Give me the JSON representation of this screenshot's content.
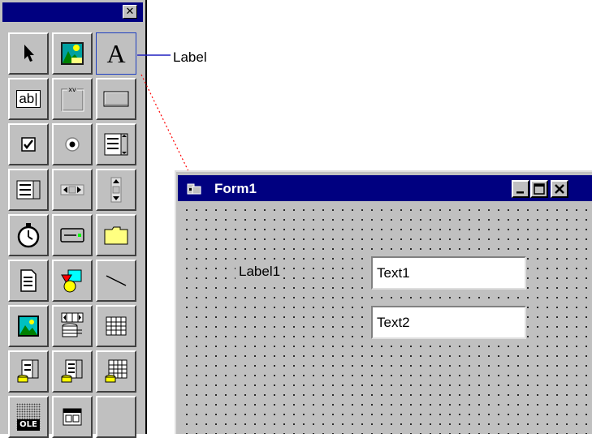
{
  "toolbox": {
    "close_glyph": "✕",
    "tools": [
      {
        "name": "pointer",
        "row": 0,
        "col": 0
      },
      {
        "name": "picture",
        "row": 0,
        "col": 1
      },
      {
        "name": "label",
        "row": 0,
        "col": 2,
        "selected": true,
        "glyph": "A"
      },
      {
        "name": "textbox",
        "row": 1,
        "col": 0,
        "glyph": "ab|"
      },
      {
        "name": "frame",
        "row": 1,
        "col": 1,
        "glyph": "xv"
      },
      {
        "name": "command-button",
        "row": 1,
        "col": 2
      },
      {
        "name": "checkbox",
        "row": 2,
        "col": 0
      },
      {
        "name": "option-button",
        "row": 2,
        "col": 1
      },
      {
        "name": "combobox",
        "row": 2,
        "col": 2
      },
      {
        "name": "listbox",
        "row": 3,
        "col": 0
      },
      {
        "name": "hscrollbar",
        "row": 3,
        "col": 1
      },
      {
        "name": "vscrollbar",
        "row": 3,
        "col": 2
      },
      {
        "name": "timer",
        "row": 4,
        "col": 0
      },
      {
        "name": "drivelistbox",
        "row": 4,
        "col": 1
      },
      {
        "name": "dirlistbox",
        "row": 4,
        "col": 2
      },
      {
        "name": "filelistbox",
        "row": 5,
        "col": 0
      },
      {
        "name": "shape",
        "row": 5,
        "col": 1
      },
      {
        "name": "line",
        "row": 5,
        "col": 2
      },
      {
        "name": "image",
        "row": 6,
        "col": 0
      },
      {
        "name": "data",
        "row": 6,
        "col": 1
      },
      {
        "name": "grid",
        "row": 6,
        "col": 2
      },
      {
        "name": "dbcombo",
        "row": 7,
        "col": 0
      },
      {
        "name": "dblist",
        "row": 7,
        "col": 1
      },
      {
        "name": "dbgrid",
        "row": 7,
        "col": 2
      },
      {
        "name": "ole",
        "row": 8,
        "col": 0,
        "glyph": "OLE"
      },
      {
        "name": "custom-control",
        "row": 8,
        "col": 1
      },
      {
        "name": "empty",
        "row": 8,
        "col": 2
      }
    ]
  },
  "callout": {
    "label": "Label"
  },
  "form": {
    "title": "Form1",
    "label1": "Label1",
    "text1": "Text1",
    "text2": "Text2"
  },
  "colors": {
    "titlebar": "#000080",
    "face": "#c0c0c0",
    "callout_line": "#2020c0",
    "dotted_line": "#ff0000"
  }
}
